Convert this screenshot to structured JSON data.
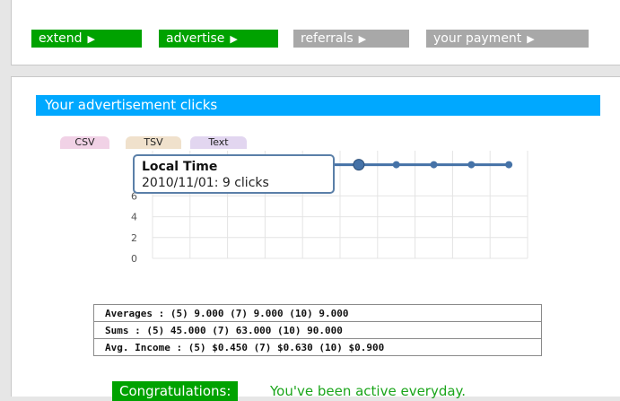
{
  "nav": {
    "items": [
      {
        "label": "extend",
        "active": true
      },
      {
        "label": "advertise",
        "active": true
      },
      {
        "label": "referrals",
        "active": false
      },
      {
        "label": "your payment",
        "active": false
      }
    ],
    "arrow_icon": "triangle-right-icon"
  },
  "section": {
    "title": "Your advertisement clicks"
  },
  "export_buttons": [
    {
      "label": "CSV",
      "color": "#f1d2e6"
    },
    {
      "label": "TSV",
      "color": "#f0e1cc"
    },
    {
      "label": "Text",
      "color": "#e2d6f0"
    }
  ],
  "tooltip": {
    "title": "Local Time",
    "body": "2010/11/01: 9 clicks"
  },
  "stats": {
    "averages": "Averages : (5) 9.000 (7) 9.000 (10) 9.000",
    "sums": "Sums : (5) 45.000 (7) 63.000 (10) 90.000",
    "avg_income": "Avg. Income : (5) $0.450 (7) $0.630 (10) $0.900"
  },
  "congrats": {
    "badge": "Congratulations:",
    "text": "You've been active everyday."
  },
  "colors": {
    "green": "#00a200",
    "gray_button": "#a8a8a8",
    "title_bar": "#00a8ff",
    "series": "#4572a7",
    "grid": "#e4e4e4",
    "congrats_text": "#1aa51a"
  },
  "chart_data": {
    "type": "line",
    "y_ticks": [
      "0",
      "2",
      "4",
      "6"
    ],
    "ylim": [
      0,
      10
    ],
    "series": [
      {
        "values": [
          9,
          9,
          9,
          9,
          9,
          9,
          9,
          9,
          9,
          9
        ]
      }
    ],
    "highlighted_index": 5,
    "grid": true
  }
}
